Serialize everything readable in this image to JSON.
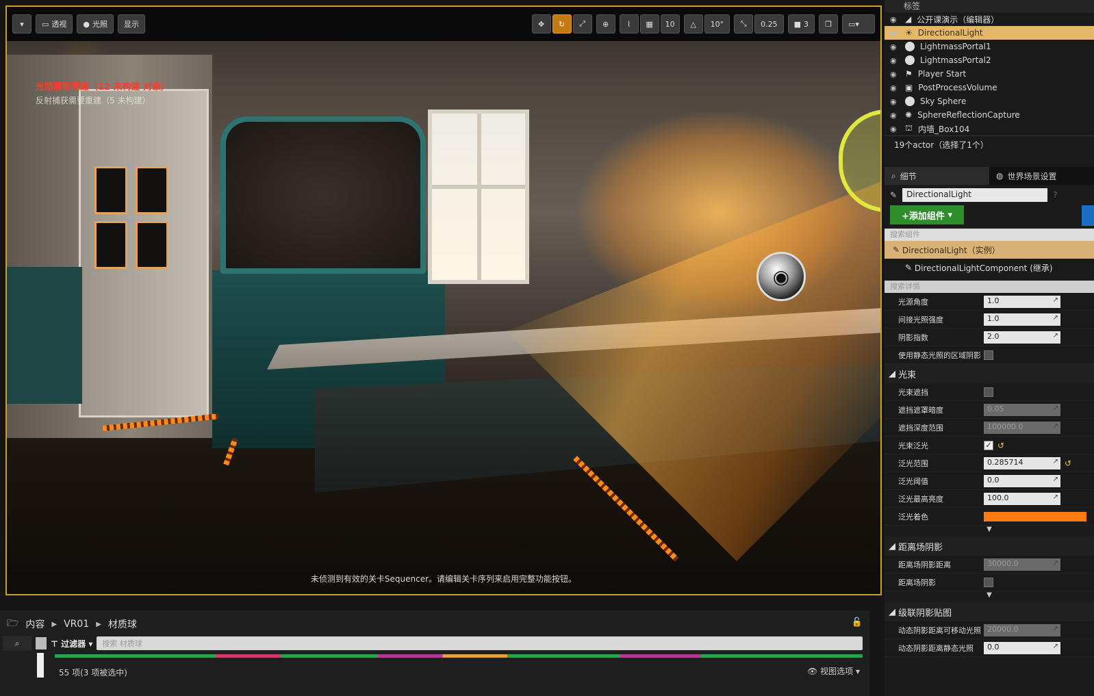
{
  "viewport": {
    "toolbar": {
      "view_dropdown": "▾",
      "perspective": "透视",
      "lit": "光照",
      "show": "显示",
      "grid_snap": "10",
      "angle_snap": "10°",
      "scale_snap": "0.25",
      "camera_speed": "3"
    },
    "warning_red": "光照需要重建（12 未构建 对象）",
    "warning_white": "反射捕获需要重建（5 未构建）",
    "sequencer_msg": "未侦测到有效的关卡Sequencer。请编辑关卡序列来启用完整功能按钮。"
  },
  "content_browser": {
    "breadcrumb": [
      "内容",
      "VR01",
      "材质球"
    ],
    "filter_label": "过滤器",
    "search_placeholder": "搜索 材质球",
    "item_count": "55 项(3 项被选中)",
    "view_options": "视图选项"
  },
  "outliner": {
    "header": "标签",
    "items": [
      {
        "label": "公开课演示（编辑器）",
        "icon": "level-icon"
      },
      {
        "label": "DirectionalLight",
        "icon": "light-icon",
        "selected": true
      },
      {
        "label": "LightmassPortal1",
        "icon": "sphere-icon"
      },
      {
        "label": "LightmassPortal2",
        "icon": "sphere-icon"
      },
      {
        "label": "Player Start",
        "icon": "player-icon"
      },
      {
        "label": "PostProcessVolume",
        "icon": "volume-icon"
      },
      {
        "label": "Sky Sphere",
        "icon": "sphere-icon"
      },
      {
        "label": "SphereReflectionCapture",
        "icon": "capture-icon"
      },
      {
        "label": "内墙_Box104",
        "icon": "mesh-icon"
      }
    ],
    "actor_count": "19个actor（选择了1个）"
  },
  "details": {
    "tab_details": "细节",
    "tab_world": "世界场景设置",
    "name_value": "DirectionalLight",
    "add_component": "+添加组件",
    "component_search_placeholder": "搜索组件",
    "component_instance": "DirectionalLight（实例）",
    "component_child": "DirectionalLightComponent (继承)",
    "detail_search_placeholder": "搜索详情",
    "props_top": [
      {
        "label": "光源角度",
        "value": "1.0"
      },
      {
        "label": "间接光照强度",
        "value": "1.0"
      },
      {
        "label": "阴影指数",
        "value": "2.0"
      },
      {
        "label": "使用静态光照的区域阴影",
        "checkbox": false
      }
    ],
    "section_lightshaft": "光束",
    "props_shaft": [
      {
        "label": "光束遮挡",
        "checkbox": false
      },
      {
        "label": "遮挡遮罩暗度",
        "value": "0.05",
        "disabled": true
      },
      {
        "label": "遮挡深度范围",
        "value": "100000.0",
        "disabled": true
      },
      {
        "label": "光束泛光",
        "checkbox": true
      },
      {
        "label": "泛光范围",
        "value": "0.285714"
      },
      {
        "label": "泛光阈值",
        "value": "0.0"
      },
      {
        "label": "泛光最高亮度",
        "value": "100.0"
      },
      {
        "label": "泛光着色",
        "color": "#ff7a12"
      }
    ],
    "section_distance": "距离场阴影",
    "props_distance": [
      {
        "label": "距离场阴影距离",
        "value": "30000.0",
        "disabled": true
      },
      {
        "label": "距离场阴影",
        "checkbox": false
      }
    ],
    "section_cascade": "级联阴影贴图",
    "props_cascade": [
      {
        "label": "动态阴影距离可移动光照",
        "value": "20000.0",
        "disabled": true
      },
      {
        "label": "动态阴影距离静态光照",
        "value": "0.0"
      }
    ]
  },
  "colors": {
    "accent": "#c9a227",
    "selection": "#e4b868",
    "add_button": "#2e8f2a"
  }
}
